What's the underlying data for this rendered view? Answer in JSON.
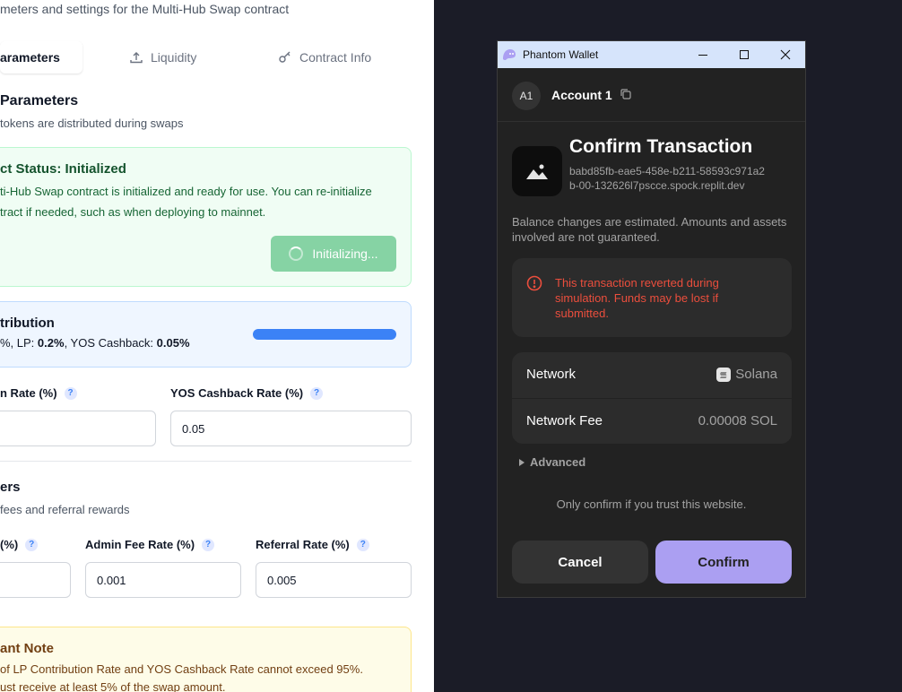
{
  "page": {
    "subtitle": "meters and settings for the Multi-Hub Swap contract",
    "tabs": [
      {
        "label": "arameters",
        "active": true
      },
      {
        "label": "Liquidity",
        "icon": "upload-icon"
      },
      {
        "label": "Contract Info",
        "icon": "key-icon"
      }
    ],
    "section_title": "Parameters",
    "section_desc": "tokens are distributed during swaps",
    "status": {
      "title": "ct Status: Initialized",
      "text_line1": "ti-Hub Swap contract is initialized and ready for use. You can re-initialize",
      "text_line2": "tract if needed, such as when deploying to mainnet.",
      "button_label": "Initializing..."
    },
    "distribution": {
      "title": "tribution",
      "prefix": "%, LP: ",
      "lp_value": "0.2%",
      "mid": ", YOS Cashback: ",
      "yos_value": "0.05%",
      "progress": 1.0
    },
    "rates": {
      "lp_label": "n Rate (%)",
      "yos_label": "YOS Cashback Rate (%)",
      "lp_value": "",
      "yos_value": "0.05"
    },
    "fees": {
      "title": "ers",
      "desc": "fees and referral rewards",
      "col1_label": "(%)",
      "admin_label": "Admin Fee Rate (%)",
      "referral_label": "Referral Rate (%)",
      "col1_value": "",
      "admin_value": "0.001",
      "referral_value": "0.005"
    },
    "note": {
      "title": "ant Note",
      "line1": "of LP Contribution Rate and YOS Cashback Rate cannot exceed 95%.",
      "line2": "ust receive at least 5% of the swap amount."
    },
    "help_glyph": "?"
  },
  "wallet": {
    "window_title": "Phantom Wallet",
    "account_initials": "A1",
    "account_name": "Account 1",
    "heading": "Confirm Transaction",
    "site_url": "babd85fb-eae5-458e-b211-58593c971a2b-00-132626l7pscce.spock.replit.dev",
    "balance_note": "Balance changes are estimated. Amounts and assets involved are not guaranteed.",
    "warning": "This transaction reverted during simulation. Funds may be lost if submitted.",
    "network_label": "Network",
    "network_value": "Solana",
    "fee_label": "Network Fee",
    "fee_value": "0.00008 SOL",
    "advanced_label": "Advanced",
    "trust_note": "Only confirm if you trust this website.",
    "cancel_label": "Cancel",
    "confirm_label": "Confirm"
  },
  "colors": {
    "wallet_bg": "#222222",
    "confirm_accent": "#ab9ff2",
    "warning_red": "#eb4e3d",
    "backdrop": "#1b1c27",
    "progress_blue": "#3b82f6"
  }
}
